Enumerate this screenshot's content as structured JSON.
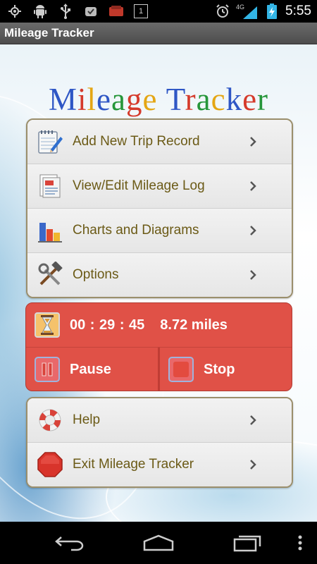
{
  "status_bar": {
    "time": "5:55",
    "network": "4G",
    "notification_count": "1",
    "icons": [
      "gps-icon",
      "android-debug-icon",
      "usb-icon",
      "notification-icon",
      "app-notification-icon",
      "count-notification-icon"
    ],
    "right_icons": [
      "alarm-icon",
      "signal-icon",
      "battery-charging-icon"
    ]
  },
  "app": {
    "title": "Mileage Tracker",
    "logo_letters": [
      {
        "ch": "M",
        "color": "#2e56c5"
      },
      {
        "ch": "i",
        "color": "#d53a2b"
      },
      {
        "ch": "l",
        "color": "#e4a614"
      },
      {
        "ch": "e",
        "color": "#2e56c5"
      },
      {
        "ch": "a",
        "color": "#26963a"
      },
      {
        "ch": "g",
        "color": "#d53a2b"
      },
      {
        "ch": "e",
        "color": "#e4a614"
      },
      {
        "ch": " ",
        "color": "#000000"
      },
      {
        "ch": "T",
        "color": "#2e56c5"
      },
      {
        "ch": "r",
        "color": "#d53a2b"
      },
      {
        "ch": "a",
        "color": "#26963a"
      },
      {
        "ch": "c",
        "color": "#e4a614"
      },
      {
        "ch": "k",
        "color": "#2e56c5"
      },
      {
        "ch": "e",
        "color": "#d53a2b"
      },
      {
        "ch": "r",
        "color": "#26963a"
      }
    ]
  },
  "menu": {
    "items": [
      {
        "label": "Add New Trip Record",
        "icon": "notepad-pencil-icon"
      },
      {
        "label": "View/Edit Mileage Log",
        "icon": "log-document-icon"
      },
      {
        "label": "Charts and Diagrams",
        "icon": "bar-chart-icon"
      },
      {
        "label": "Options",
        "icon": "tools-icon"
      }
    ]
  },
  "timer": {
    "elapsed": "00 : 29 : 45",
    "distance": "8.72 miles",
    "pause_label": "Pause",
    "stop_label": "Stop"
  },
  "help_menu": {
    "items": [
      {
        "label": "Help",
        "icon": "lifebuoy-icon"
      },
      {
        "label": "Exit Mileage Tracker",
        "icon": "stop-sign-icon"
      }
    ]
  },
  "colors": {
    "accent_red": "#e05147",
    "menu_text": "#6b5a16",
    "card_border": "#9b8f6c"
  },
  "nav_bar": {
    "icons": [
      "back-icon",
      "home-icon",
      "recent-apps-icon",
      "overflow-menu-icon"
    ]
  }
}
